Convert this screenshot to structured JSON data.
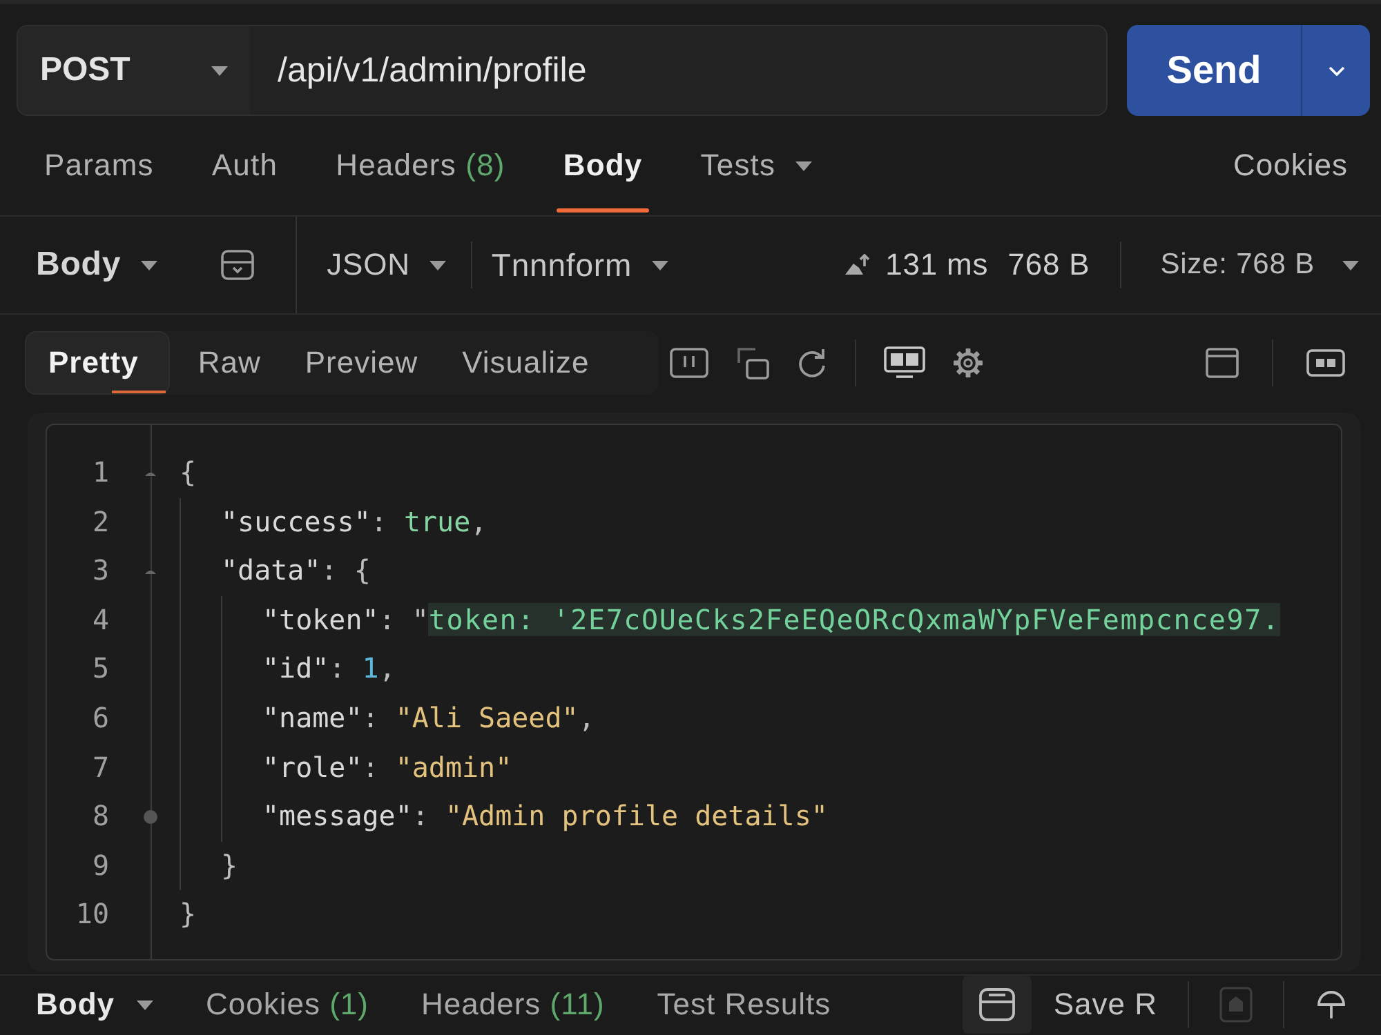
{
  "request": {
    "method": "POST",
    "url": "/api/v1/admin/profile",
    "send": "Send"
  },
  "request_tabs": [
    {
      "label": "Params",
      "selected": false,
      "dropdown": false
    },
    {
      "label": "Auth",
      "selected": false,
      "dropdown": false
    },
    {
      "label": "Headers",
      "count": "(8)",
      "selected": false,
      "dropdown": false
    },
    {
      "label": "Body",
      "selected": true,
      "dropdown": false
    },
    {
      "label": "Tests",
      "selected": false,
      "dropdown": true
    }
  ],
  "cookies": "Cookies",
  "body_toolbar": {
    "section": "Body",
    "format": "JSON",
    "transform": "Tnnnform",
    "time": "131 ms",
    "size": "768 B",
    "size_menu": "Size: 768 B"
  },
  "response_tabs": [
    {
      "label": "Pretty",
      "selected": true
    },
    {
      "label": "Raw",
      "selected": false
    },
    {
      "label": "Preview",
      "selected": false
    },
    {
      "label": "Visualize",
      "selected": false
    }
  ],
  "editor": {
    "lines": [
      {
        "number": "1",
        "breakpoint": false,
        "tokens": [
          {
            "kind": "punct",
            "text": "{"
          }
        ],
        "children": [
          {
            "number": "2",
            "breakpoint": false,
            "tokens": [
              {
                "kind": "key",
                "text": "\"success\""
              },
              {
                "kind": "punct",
                "text": ": "
              },
              {
                "kind": "bool",
                "text": "true"
              },
              {
                "kind": "punct",
                "text": ","
              }
            ]
          },
          {
            "number": "3",
            "breakpoint": false,
            "tokens": [
              {
                "kind": "key",
                "text": "\"data\""
              },
              {
                "kind": "punct",
                "text": ": {"
              }
            ],
            "children": [
              {
                "number": "4",
                "breakpoint": false,
                "tokens": [
                  {
                    "kind": "key",
                    "text": "\"token\""
                  },
                  {
                    "kind": "punct",
                    "text": ": \""
                  },
                  {
                    "kind": "highlight",
                    "text": "token: '2E7cOUeCks2FeEQeORcQxmaWYpFVeFempcnce97."
                  }
                ]
              },
              {
                "number": "5",
                "breakpoint": false,
                "tokens": [
                  {
                    "kind": "key",
                    "text": "\"id\""
                  },
                  {
                    "kind": "punct",
                    "text": ": "
                  },
                  {
                    "kind": "number",
                    "text": "1"
                  },
                  {
                    "kind": "punct",
                    "text": ","
                  }
                ]
              },
              {
                "number": "6",
                "breakpoint": false,
                "tokens": [
                  {
                    "kind": "key",
                    "text": "\"name\""
                  },
                  {
                    "kind": "punct",
                    "text": ": "
                  },
                  {
                    "kind": "string",
                    "text": "\"Ali Saeed\""
                  },
                  {
                    "kind": "punct",
                    "text": ","
                  }
                ]
              },
              {
                "number": "7",
                "breakpoint": false,
                "tokens": [
                  {
                    "kind": "key",
                    "text": "\"role\""
                  },
                  {
                    "kind": "punct",
                    "text": ": "
                  },
                  {
                    "kind": "string",
                    "text": "\"admin\""
                  }
                ]
              },
              {
                "number": "8",
                "breakpoint": true,
                "tokens": [
                  {
                    "kind": "key",
                    "text": "\"message\""
                  },
                  {
                    "kind": "punct",
                    "text": ": "
                  },
                  {
                    "kind": "string",
                    "text": "\"Admin profile details\""
                  }
                ]
              }
            ]
          },
          {
            "number": "9",
            "breakpoint": false,
            "tokens": [
              {
                "kind": "punct",
                "text": "}"
              }
            ]
          }
        ]
      },
      {
        "number": "10",
        "breakpoint": false,
        "tokens": [
          {
            "kind": "punct",
            "text": "}"
          }
        ]
      }
    ]
  },
  "footer": {
    "tabs": [
      {
        "label": "Body",
        "selected": true,
        "dropdown": true
      },
      {
        "label": "Cookies",
        "count": "(1)",
        "selected": false,
        "dropdown": false
      },
      {
        "label": "Headers",
        "count": "(11)",
        "selected": false,
        "dropdown": false
      },
      {
        "label": "Test Results",
        "selected": false,
        "dropdown": false
      }
    ],
    "save": "Save R"
  }
}
